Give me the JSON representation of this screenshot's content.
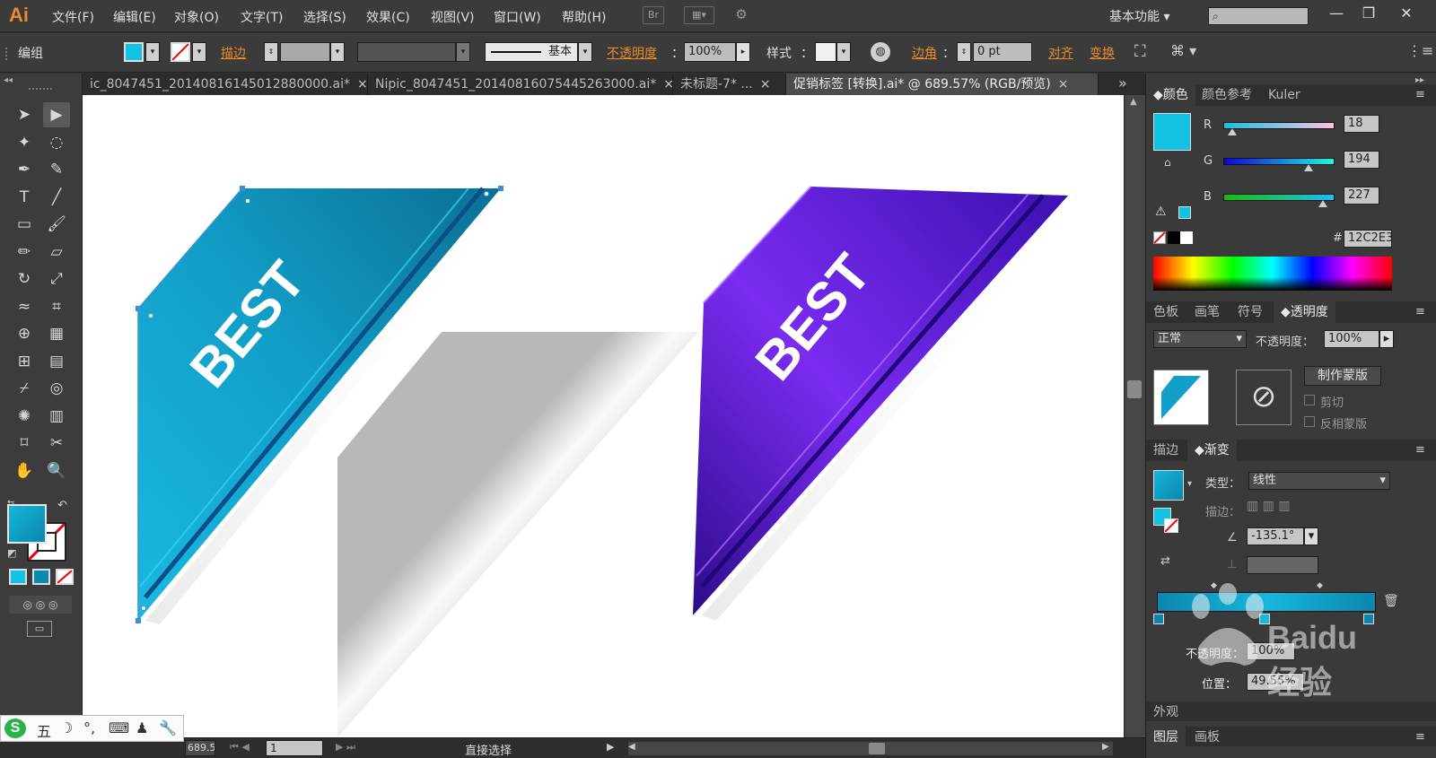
{
  "app": {
    "logo": "Ai",
    "workspace": "基本功能"
  },
  "menu": [
    "文件(F)",
    "编辑(E)",
    "对象(O)",
    "文字(T)",
    "选择(S)",
    "效果(C)",
    "视图(V)",
    "窗口(W)",
    "帮助(H)"
  ],
  "menu_icons": {
    "bridge": "Br"
  },
  "window_buttons": {
    "minimize": "—",
    "restore": "❐",
    "close": "✕"
  },
  "control": {
    "group_label": "编组",
    "stroke_label": "描边",
    "stroke_weight_label": "基本",
    "opacity_label": "不透明度",
    "opacity_value": "100%",
    "style_label": "样式",
    "corner_label": "边角",
    "corner_value": "0 pt",
    "align_label": "对齐",
    "transform_label": "变换",
    "fill_color": "#12C2E3"
  },
  "tabs": [
    {
      "label": "ic_8047451_20140816145012880000.ai*",
      "active": false
    },
    {
      "label": "Nipic_8047451_20140816075445263000.ai*",
      "active": false
    },
    {
      "label": "未标题-7* ...",
      "active": false
    },
    {
      "label": "促销标签 [转换].ai* @ 689.57% (RGB/预览)",
      "active": true
    }
  ],
  "tab_close": "×",
  "tab_overflow": "»",
  "tools": [
    "selection-icon",
    "direct-selection-icon",
    "magic-wand-icon",
    "lasso-icon",
    "pen-icon",
    "curvature-icon",
    "type-icon",
    "line-icon",
    "rectangle-icon",
    "brush-icon",
    "pencil-icon",
    "eraser-icon",
    "rotate-icon",
    "scale-icon",
    "warp-icon",
    "free-transform-icon",
    "shape-builder-icon",
    "graph-icon",
    "mesh-icon",
    "gradient-icon",
    "eyedropper-icon",
    "blend-icon",
    "symbol-sprayer-icon",
    "column-graph-icon",
    "artboard-icon",
    "slice-icon",
    "hand-icon",
    "zoom-icon"
  ],
  "artwork": {
    "ribbon_text_1": "BEST",
    "ribbon_text_2": "BEST",
    "blue_dark": "#0a7ea3",
    "blue_light": "#16b6dc",
    "purple_dark": "#3a0fa6",
    "purple_light": "#6a22e0"
  },
  "color_panel": {
    "tabs": [
      "颜色",
      "颜色参考",
      "Kuler"
    ],
    "r_label": "R",
    "r_value": "18",
    "g_label": "G",
    "g_value": "194",
    "b_label": "B",
    "b_value": "227",
    "hex_label": "#",
    "hex_value": "12C2E3",
    "r_level": 0.07,
    "g_level": 0.76,
    "b_level": 0.89,
    "color": "#12C2E3"
  },
  "transparency_panel": {
    "tabs": [
      "色板",
      "画笔",
      "符号",
      "透明度"
    ],
    "blend_mode": "正常",
    "opacity_label": "不透明度：",
    "opacity_value": "100%",
    "make_mask": "制作蒙版",
    "clip": "剪切",
    "invert_mask": "反相蒙版"
  },
  "gradient_panel": {
    "tabs": [
      "描边",
      "渐变"
    ],
    "type_label": "类型：",
    "type_value": "线性",
    "stroke_label": "描边：",
    "angle_value": "-135.1°",
    "opacity_label": "不透明度：",
    "opacity_value": "100%",
    "position_label": "位置：",
    "position_value": "49.55%"
  },
  "bottom_panels": {
    "appearance": "外观",
    "layers": "图层",
    "artboards": "画板"
  },
  "status": {
    "zoom": "689.57",
    "page": "1",
    "tool_name": "直接选择"
  },
  "ime": {
    "logo": "S",
    "mode": "五"
  },
  "watermark": {
    "text": "Baidu 经验"
  }
}
